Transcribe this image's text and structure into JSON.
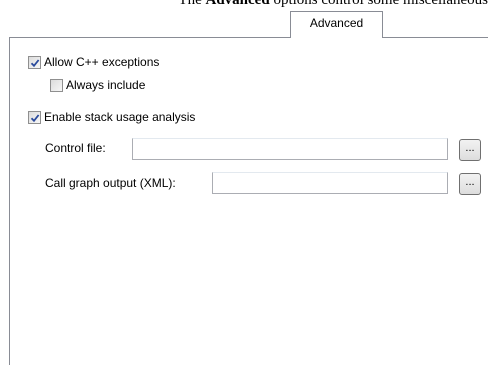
{
  "caption": {
    "prefix": "The ",
    "bold": "Advanced",
    "suffix": " options control some miscellaneous"
  },
  "tabs": [
    {
      "label": "Advanced",
      "selected": true
    }
  ],
  "options": {
    "allow_cpp_exceptions": {
      "label": "Allow C++ exceptions",
      "checked": true
    },
    "always_include": {
      "label": "Always include",
      "checked": false
    },
    "enable_stack_usage": {
      "label": "Enable stack usage analysis",
      "checked": true
    }
  },
  "fields": {
    "control_file": {
      "label": "Control file:",
      "value": ""
    },
    "call_graph_output": {
      "label": "Call graph output (XML):",
      "value": ""
    }
  },
  "browse_label": "...",
  "colors": {
    "check_mark": "#2a4a9c",
    "border": "#898c95"
  }
}
